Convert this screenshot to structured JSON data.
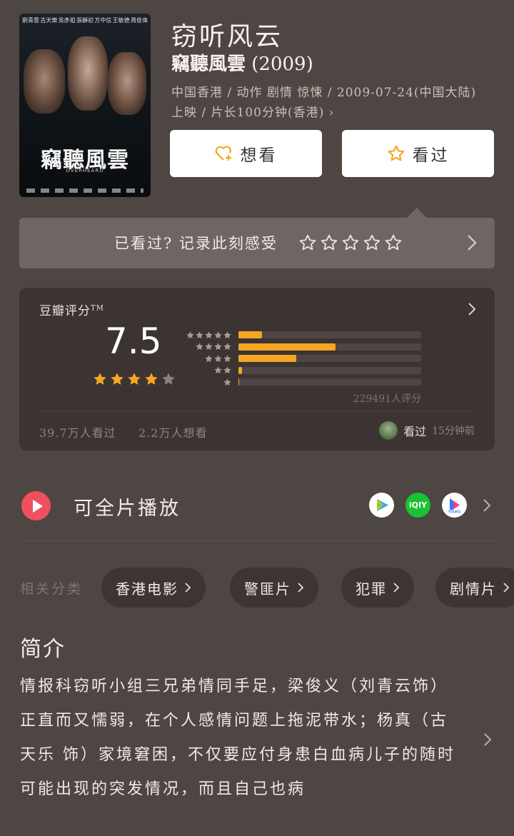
{
  "poster": {
    "cast": [
      "劉青雲",
      "古天樂",
      "吳彥祖",
      "張靜初",
      "方中信",
      "王敏德",
      "周俊偉"
    ],
    "title": "竊聽風雲",
    "subtitle": "OVERHEARD"
  },
  "movie": {
    "title": "窃听风云",
    "original_title": "竊聽風雲",
    "year": "(2009)",
    "meta_line1": "中国香港 / 动作 剧情 惊悚 / 2009-07-24(中国大陆)",
    "meta_line2": "上映 / 片长100分钟(香港) ›"
  },
  "actions": {
    "want_label": "想看",
    "seen_label": "看过"
  },
  "record": {
    "prompt": "已看过? 记录此刻感受",
    "star_count": 5
  },
  "rating": {
    "label": "豆瓣评分",
    "label_mark": "TM",
    "score": "7.5",
    "stars": 4,
    "count_text": "229491人评分",
    "watched_text": "39.7万人看过",
    "wish_text": "2.2万人想看",
    "friend_action": "看过",
    "friend_time": "15分钟前",
    "distribution": [
      {
        "stars": 5,
        "percent": 12.7
      },
      {
        "stars": 4,
        "percent": 53.2
      },
      {
        "stars": 3,
        "percent": 31.7
      },
      {
        "stars": 2,
        "percent": 2.0
      },
      {
        "stars": 1,
        "percent": 0.4
      }
    ]
  },
  "play": {
    "label": "可全片播放",
    "sources": [
      "tencent-video",
      "iqiyi",
      "youku"
    ],
    "iqiyi_text": "iQIY"
  },
  "categories": {
    "label": "相关分类",
    "items": [
      "香港电影",
      "警匪片",
      "犯罪",
      "剧情片"
    ]
  },
  "intro": {
    "heading": "简介",
    "text": "情报科窃听小组三兄弟情同手足，梁俊义（刘青云饰）正直而又懦弱，在个人感情问题上拖泥带水；杨真（古天乐 饰）家境窘困，不仅要应付身患白血病儿子的随时可能出现的突发情况，而且自己也病"
  },
  "colors": {
    "background": "#4e4643",
    "star": "#f5a623",
    "play": "#ef4f5e",
    "iqiyi": "#1bc232"
  }
}
